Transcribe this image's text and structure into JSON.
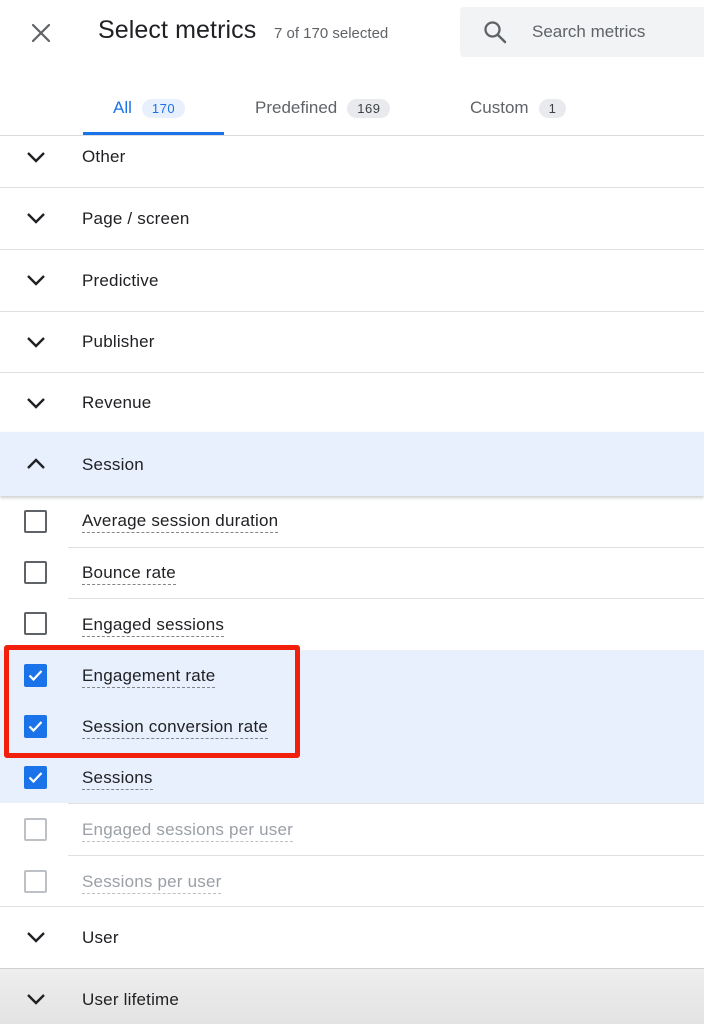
{
  "header": {
    "title": "Select metrics",
    "selection_status": "7 of 170 selected",
    "search_placeholder": "Search metrics"
  },
  "tabs": [
    {
      "label": "All",
      "count": "170",
      "active": true
    },
    {
      "label": "Predefined",
      "count": "169",
      "active": false
    },
    {
      "label": "Custom",
      "count": "1",
      "active": false
    }
  ],
  "categories": {
    "other": "Other",
    "page_screen": "Page / screen",
    "predictive": "Predictive",
    "publisher": "Publisher",
    "revenue": "Revenue",
    "session": "Session",
    "user": "User",
    "user_lifetime": "User lifetime"
  },
  "session_metrics": [
    {
      "label": "Average session duration",
      "checked": false,
      "enabled": true
    },
    {
      "label": "Bounce rate",
      "checked": false,
      "enabled": true
    },
    {
      "label": "Engaged sessions",
      "checked": false,
      "enabled": true
    },
    {
      "label": "Engagement rate",
      "checked": true,
      "enabled": true
    },
    {
      "label": "Session conversion rate",
      "checked": true,
      "enabled": true
    },
    {
      "label": "Sessions",
      "checked": true,
      "enabled": true
    },
    {
      "label": "Engaged sessions per user",
      "checked": false,
      "enabled": false
    },
    {
      "label": "Sessions per user",
      "checked": false,
      "enabled": false
    }
  ],
  "colors": {
    "accent": "#1a73e8",
    "highlight": "#f21f0c",
    "selected_bg": "#e8f0fe"
  }
}
